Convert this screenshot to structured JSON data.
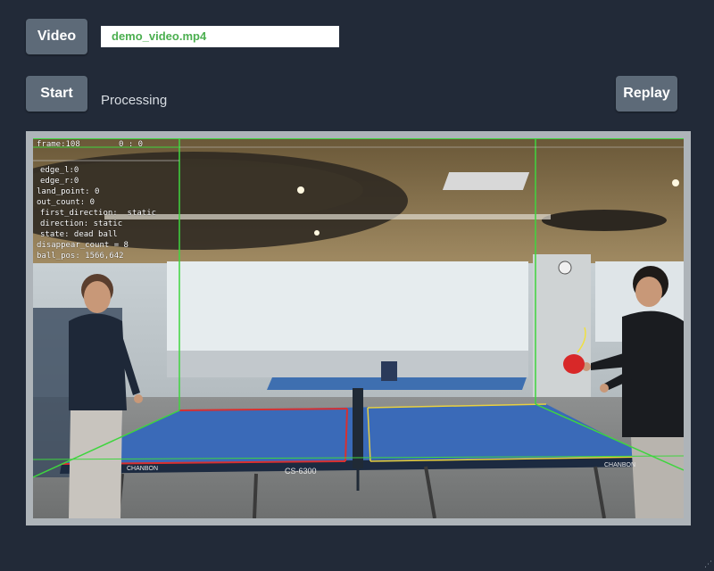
{
  "toolbar": {
    "video_label": "Video",
    "file_name": "demo_video.mp4",
    "start_label": "Start",
    "status": "Processing",
    "replay_label": "Replay"
  },
  "overlay": {
    "frame": "frame:108",
    "score": "0 : 0",
    "edge_l": "edge_l:0",
    "edge_r": "edge_r:0",
    "land_point": "land_point: 0",
    "out_count": "out_count: 0",
    "first_direction": "first_direction:  static",
    "direction": "direction: static",
    "state": "state: dead ball",
    "disappear_count": "disappear_count = 8",
    "ball_pos": "ball_pos: 1566,642"
  },
  "scene": {
    "table_brand_left": "CHANBON",
    "table_brand_right": "CHANBON",
    "table_model": "CS-6300"
  },
  "colors": {
    "background": "#222a38",
    "button": "#5d6a78",
    "filename_text": "#4caf50",
    "guide_green": "#3fd53f",
    "table_blue": "#3a6ab8",
    "edge_red": "#d83030",
    "edge_yellow": "#e8d040"
  }
}
